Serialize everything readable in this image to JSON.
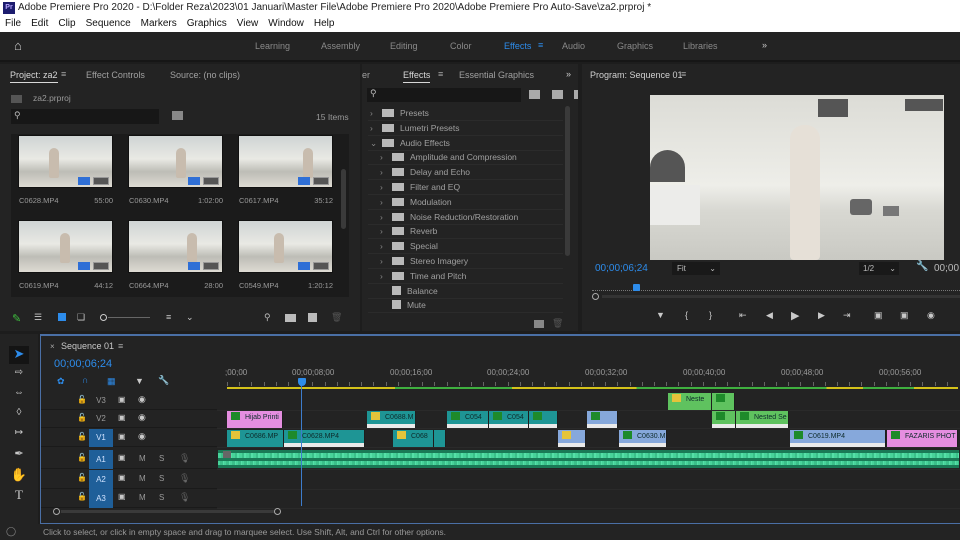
{
  "window": {
    "title": "Adobe Premiere Pro 2020 - D:\\Folder Reza\\2023\\01 Januari\\Master File\\Adobe Premiere Pro 2020\\Adobe Premiere Pro Auto-Save\\za2.prproj *",
    "logo": "Pr"
  },
  "menu": [
    "File",
    "Edit",
    "Clip",
    "Sequence",
    "Markers",
    "Graphics",
    "View",
    "Window",
    "Help"
  ],
  "workspaces": [
    "Learning",
    "Assembly",
    "Editing",
    "Color",
    "Effects",
    "Audio",
    "Graphics",
    "Libraries"
  ],
  "workspace_active": "Effects",
  "accent": "#2d8ceb",
  "project": {
    "tabs": [
      "Project: za2",
      "Effect Controls",
      "Source: (no clips)"
    ],
    "file": "za2.prproj",
    "search_placeholder": "",
    "count": "15 Items",
    "items": [
      {
        "name": "C0628.MP4",
        "duration": "55:00"
      },
      {
        "name": "C0630.MP4",
        "duration": "1:02:00"
      },
      {
        "name": "C0617.MP4",
        "duration": "35:12"
      },
      {
        "name": "C0619.MP4",
        "duration": "44:12"
      },
      {
        "name": "C0664.MP4",
        "duration": "28:00"
      },
      {
        "name": "C0549.MP4",
        "duration": "1:20:12"
      }
    ]
  },
  "effects": {
    "tabs": [
      "er",
      "Effects",
      "Essential Graphics"
    ],
    "items": [
      {
        "label": "Presets",
        "level": 0,
        "type": "folder"
      },
      {
        "label": "Lumetri Presets",
        "level": 0,
        "type": "folder"
      },
      {
        "label": "Audio Effects",
        "level": 0,
        "type": "folder-open"
      },
      {
        "label": "Amplitude and Compression",
        "level": 1,
        "type": "folder"
      },
      {
        "label": "Delay and Echo",
        "level": 1,
        "type": "folder"
      },
      {
        "label": "Filter and EQ",
        "level": 1,
        "type": "folder"
      },
      {
        "label": "Modulation",
        "level": 1,
        "type": "folder"
      },
      {
        "label": "Noise Reduction/Restoration",
        "level": 1,
        "type": "folder"
      },
      {
        "label": "Reverb",
        "level": 1,
        "type": "folder"
      },
      {
        "label": "Special",
        "level": 1,
        "type": "folder"
      },
      {
        "label": "Stereo Imagery",
        "level": 1,
        "type": "folder"
      },
      {
        "label": "Time and Pitch",
        "level": 1,
        "type": "folder"
      },
      {
        "label": "Balance",
        "level": 1,
        "type": "effect"
      },
      {
        "label": "Mute",
        "level": 1,
        "type": "effect"
      }
    ]
  },
  "program": {
    "title": "Program: Sequence 01",
    "timecode": "00;00;06;24",
    "fit": "Fit",
    "resolution": "1/2",
    "duration": "00;00"
  },
  "timeline": {
    "sequence": "Sequence 01",
    "timecode": "00;00;06;24",
    "ruler": [
      ";00;00",
      "00;00;08;00",
      "00;00;16;00",
      "00;00;24;00",
      "00;00;32;00",
      "00;00;40;00",
      "00;00;48;00",
      "00;00;56;00"
    ],
    "tracks": [
      {
        "id": "V3",
        "type": "video"
      },
      {
        "id": "V2",
        "type": "video"
      },
      {
        "id": "V1",
        "type": "video"
      },
      {
        "id": "A1",
        "type": "audio"
      },
      {
        "id": "A2",
        "type": "audio"
      },
      {
        "id": "A3",
        "type": "audio"
      }
    ],
    "mute": "M",
    "solo": "S",
    "clips": {
      "v3": [
        "Neste",
        ""
      ],
      "v2": [
        "Hijab Printi",
        "C0688.M",
        "C054",
        "C054",
        "",
        "",
        "",
        "Nested Se"
      ],
      "v1": [
        "C0686.MP",
        "C0628.MP4",
        "C068",
        "",
        "",
        "C0630.M",
        "C0619.MP4",
        "FAZARIS PHOT"
      ]
    }
  },
  "status": "Click to select, or click in empty space and drag to marquee select. Use Shift, Alt, and Ctrl for other options."
}
